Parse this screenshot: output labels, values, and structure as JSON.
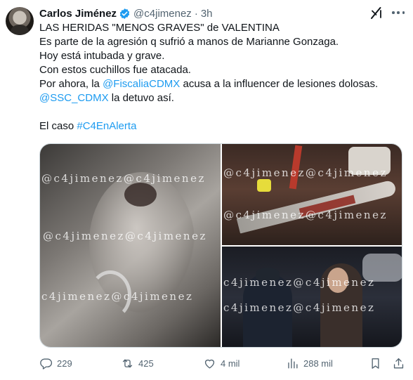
{
  "author": {
    "name": "Carlos Jiménez",
    "handle": "@c4jimenez",
    "separator": "·",
    "time": "3h"
  },
  "tweet": {
    "lines": [
      "LAS HERIDAS \"MENOS GRAVES\" de VALENTINA",
      "Es parte de la agresión q sufrió a manos de Marianne Gonzaga.",
      "Hoy está intubada y grave.",
      "Con estos cuchillos fue atacada."
    ],
    "line5_pre": "Por ahora, la ",
    "line5_mention": "@FiscaliaCDMX",
    "line5_post": " acusa a la influencer de lesiones dolosas.",
    "line6_mention": "@SSC_CDMX",
    "line6_post": " la detuvo así.",
    "line7_pre": "El caso ",
    "line7_hashtag": "#C4EnAlerta"
  },
  "media": {
    "watermark": "@c4jimenez@c4jimenez",
    "watermark_alt": "c4jimenez@c4jimenez"
  },
  "actions": {
    "replies": "229",
    "retweets": "425",
    "likes": "4 mil",
    "views": "288 mil"
  },
  "icons": {
    "verified": "verified-badge-icon",
    "grok": "grok-icon",
    "more": "more-icon",
    "reply": "reply-icon",
    "retweet": "retweet-icon",
    "like": "heart-icon",
    "views": "views-icon",
    "bookmark": "bookmark-icon",
    "share": "share-icon"
  },
  "colors": {
    "link": "#1d9bf0",
    "secondary_text": "#536471",
    "primary_text": "#0f1419"
  }
}
